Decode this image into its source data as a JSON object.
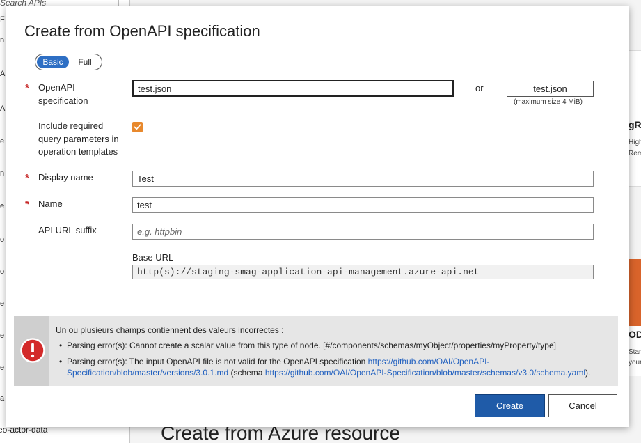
{
  "background": {
    "sidebar_search_placeholder": "Search APIs",
    "sidebar_fragments": [
      "F",
      "n",
      "A",
      "A",
      "e",
      "n",
      "e",
      "o",
      "o",
      "e",
      "e",
      "e",
      "a"
    ],
    "sidebar_item": "eo-actor-data",
    "card1": {
      "title": "gRI",
      "line1": "High",
      "line2": "Rem"
    },
    "card2": {
      "title": "OD",
      "line1": "Stan",
      "line2": "your"
    },
    "section_heading": "Create from Azure resource"
  },
  "modal": {
    "title": "Create from OpenAPI specification",
    "mode_toggle": {
      "options": [
        "Basic",
        "Full"
      ],
      "selected": "Basic"
    },
    "fields": {
      "openapi_spec": {
        "label_line1": "OpenAPI",
        "label_line2": "specification",
        "value": "test.json",
        "required": "*"
      },
      "or_text": "or",
      "file_button_label": "test.json",
      "file_hint": "(maximum size 4 MiB)",
      "include_params": {
        "label_line1": "Include required",
        "label_line2": "query parameters in",
        "label_line3": "operation templates",
        "checked": true
      },
      "display_name": {
        "label": "Display name",
        "value": "Test",
        "required": "*"
      },
      "name": {
        "label": "Name",
        "value": "test",
        "required": "*"
      },
      "api_url_suffix": {
        "label": "API URL suffix",
        "placeholder": "e.g. httpbin"
      },
      "base_url": {
        "label": "Base URL",
        "value": "http(s)://staging-smag-application-api-management.azure-api.net"
      }
    },
    "error": {
      "title": "Un ou plusieurs champs contiennent des valeurs incorrectes :",
      "item1": "Parsing error(s): Cannot create a scalar value from this type of node. [#/components/schemas/myObject/properties/myProperty/type]",
      "item2_prefix": "Parsing error(s): The input OpenAPI file is not valid for the OpenAPI specification ",
      "item2_link1": "https://github.com/OAI/OpenAPI-Specification/blob/master/versions/3.0.1.md",
      "item2_mid": " (schema ",
      "item2_link2": "https://github.com/OAI/OpenAPI-Specification/blob/master/schemas/v3.0/schema.yaml",
      "item2_suffix": ")."
    },
    "buttons": {
      "create": "Create",
      "cancel": "Cancel"
    }
  }
}
